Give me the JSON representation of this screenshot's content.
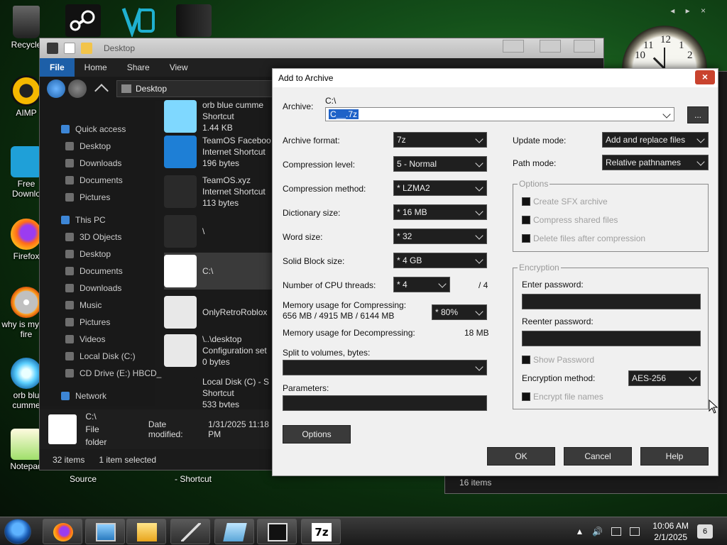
{
  "desktop": {
    "icons": [
      {
        "label": "Recycle"
      },
      {
        "label": "AIMP"
      },
      {
        "label": "Free Downlo"
      },
      {
        "label": "Firefox"
      },
      {
        "label": "why is my on fire"
      },
      {
        "label": "orb blu cumme"
      },
      {
        "label": "Notepad"
      }
    ],
    "below_labels": {
      "left": "Source",
      "right": "- Shortcut"
    },
    "gadget_controls": "◂ ▸ ×"
  },
  "explorer": {
    "title": "Desktop",
    "menu": [
      "File",
      "Home",
      "Share",
      "View"
    ],
    "address": "Desktop",
    "nav": [
      {
        "label": "Quick access",
        "indent": 0
      },
      {
        "label": "Desktop",
        "indent": 1
      },
      {
        "label": "Downloads",
        "indent": 1
      },
      {
        "label": "Documents",
        "indent": 1
      },
      {
        "label": "Pictures",
        "indent": 1
      },
      {
        "label": "This PC",
        "indent": 0
      },
      {
        "label": "3D Objects",
        "indent": 1
      },
      {
        "label": "Desktop",
        "indent": 1
      },
      {
        "label": "Documents",
        "indent": 1
      },
      {
        "label": "Downloads",
        "indent": 1
      },
      {
        "label": "Music",
        "indent": 1
      },
      {
        "label": "Pictures",
        "indent": 1
      },
      {
        "label": "Videos",
        "indent": 1
      },
      {
        "label": "Local Disk (C:)",
        "indent": 1
      },
      {
        "label": "CD Drive (E:) HBCD_",
        "indent": 1
      },
      {
        "label": "Network",
        "indent": 0
      }
    ],
    "files": [
      {
        "line1": "orb blue cumme",
        "line2": "Shortcut",
        "line3": "1.44 KB"
      },
      {
        "line1": "TeamOS Faceboo",
        "line2": "Internet Shortcut",
        "line3": "196 bytes"
      },
      {
        "line1": "TeamOS.xyz",
        "line2": "Internet Shortcut",
        "line3": "113 bytes"
      },
      {
        "line1": "\\",
        "line2": "",
        "line3": ""
      },
      {
        "line1": "C:\\",
        "line2": "",
        "line3": ""
      },
      {
        "line1": "OnlyRetroRoblox",
        "line2": "",
        "line3": ""
      },
      {
        "line1": "\\..\\desktop",
        "line2": "Configuration set",
        "line3": "0 bytes"
      },
      {
        "line1": "Local Disk (C) - S",
        "line2": "Shortcut",
        "line3": "533 bytes"
      }
    ],
    "details": {
      "name": "C:\\",
      "type": "File folder",
      "modified_label": "Date modified:",
      "modified_value": "1/31/2025 11:18 PM"
    },
    "status": {
      "count": "32 items",
      "selected": "1 item selected"
    }
  },
  "bg_window": {
    "status": "16 items"
  },
  "dialog": {
    "title": "Add to Archive",
    "close": "×",
    "archive_label": "Archive:",
    "archive_path": "C:\\",
    "archive_name": "C__.7z",
    "browse": "...",
    "format_label": "Archive format:",
    "format_value": "7z",
    "level_label": "Compression level:",
    "level_value": "5 - Normal",
    "method_label": "Compression method:",
    "method_value": "* LZMA2",
    "dict_label": "Dictionary size:",
    "dict_value": "* 16 MB",
    "word_label": "Word size:",
    "word_value": "* 32",
    "solid_label": "Solid Block size:",
    "solid_value": "* 4 GB",
    "threads_label": "Number of CPU threads:",
    "threads_value": "* 4",
    "threads_total": "/ 4",
    "mem_comp_label": "Memory usage for Compressing:",
    "mem_comp_detail": "656 MB / 4915 MB / 6144 MB",
    "mem_comp_value": "* 80%",
    "mem_decomp_label": "Memory usage for Decompressing:",
    "mem_decomp_value": "18 MB",
    "split_label": "Split to volumes, bytes:",
    "split_value": "",
    "params_label": "Parameters:",
    "params_value": "",
    "options_btn": "Options",
    "update_label": "Update mode:",
    "update_value": "Add and replace files",
    "path_label": "Path mode:",
    "path_value": "Relative pathnames",
    "options_group": "Options",
    "opt_sfx": "Create SFX archive",
    "opt_shared": "Compress shared files",
    "opt_delete": "Delete files after compression",
    "enc_group": "Encryption",
    "enter_pw": "Enter password:",
    "reenter_pw": "Reenter password:",
    "show_pw": "Show Password",
    "enc_method_label": "Encryption method:",
    "enc_method_value": "AES-256",
    "enc_names": "Encrypt file names",
    "ok": "OK",
    "cancel": "Cancel",
    "help": "Help"
  },
  "taskbar": {
    "time": "10:06 AM",
    "date": "2/1/2025",
    "notif_count": "6",
    "app_7z": "7z"
  },
  "clock_gadget": {
    "n12": "12",
    "n1": "1",
    "n2": "2",
    "n10": "10",
    "n11": "11"
  }
}
